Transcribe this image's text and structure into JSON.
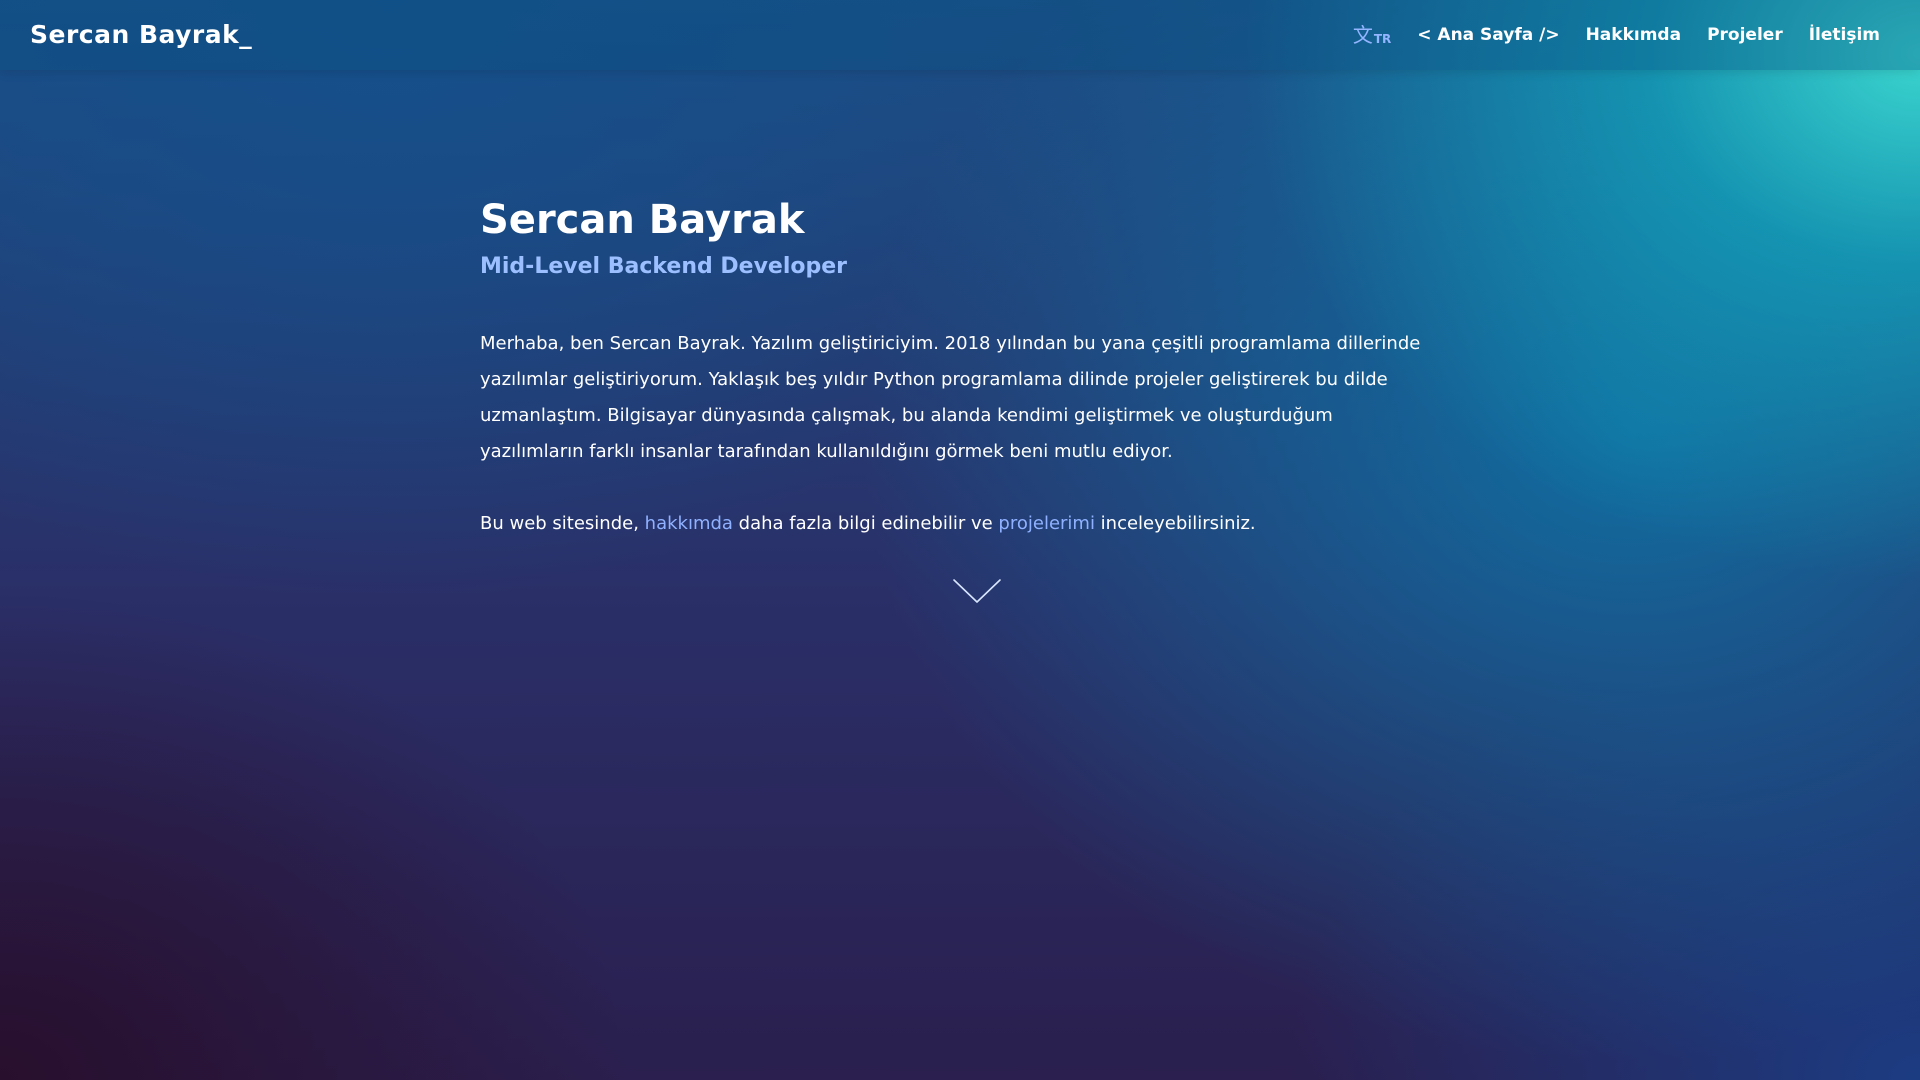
{
  "navbar": {
    "brand": "Sercan Bayrak_",
    "lang": {
      "icon": "translate-icon",
      "glyph": "文",
      "code": "TR"
    },
    "links": [
      {
        "label": "< Ana Sayfa />"
      },
      {
        "label": "Hakkımda"
      },
      {
        "label": "Projeler"
      },
      {
        "label": "İletişim"
      }
    ]
  },
  "hero": {
    "name": "Sercan Bayrak",
    "role": "Mid-Level Backend Developer",
    "intro": "Merhaba, ben Sercan Bayrak. Yazılım geliştiriciyim. 2018 yılından bu yana çeşitli programlama dillerinde yazılımlar geliştiriyorum. Yaklaşık beş yıldır Python programlama dilinde projeler geliştirerek bu dilde uzmanlaştım. Bilgisayar dünyasında çalışmak, bu alanda kendimi geliştirmek ve oluşturduğum yazılımların farklı insanlar tarafından kullanıldığını görmek beni mutlu ediyor.",
    "links_sentence": {
      "part1": "Bu web sitesinde, ",
      "link1": "hakkımda",
      "part2": " daha fazla bilgi edinebilir ve ",
      "link2": "projelerimi",
      "part3": " inceleyebilirsiniz."
    },
    "scroll_icon": "chevron-down-icon"
  },
  "colors": {
    "accent": "#9cc0ff",
    "link": "#8fb1ff",
    "text": "#ffffff"
  }
}
